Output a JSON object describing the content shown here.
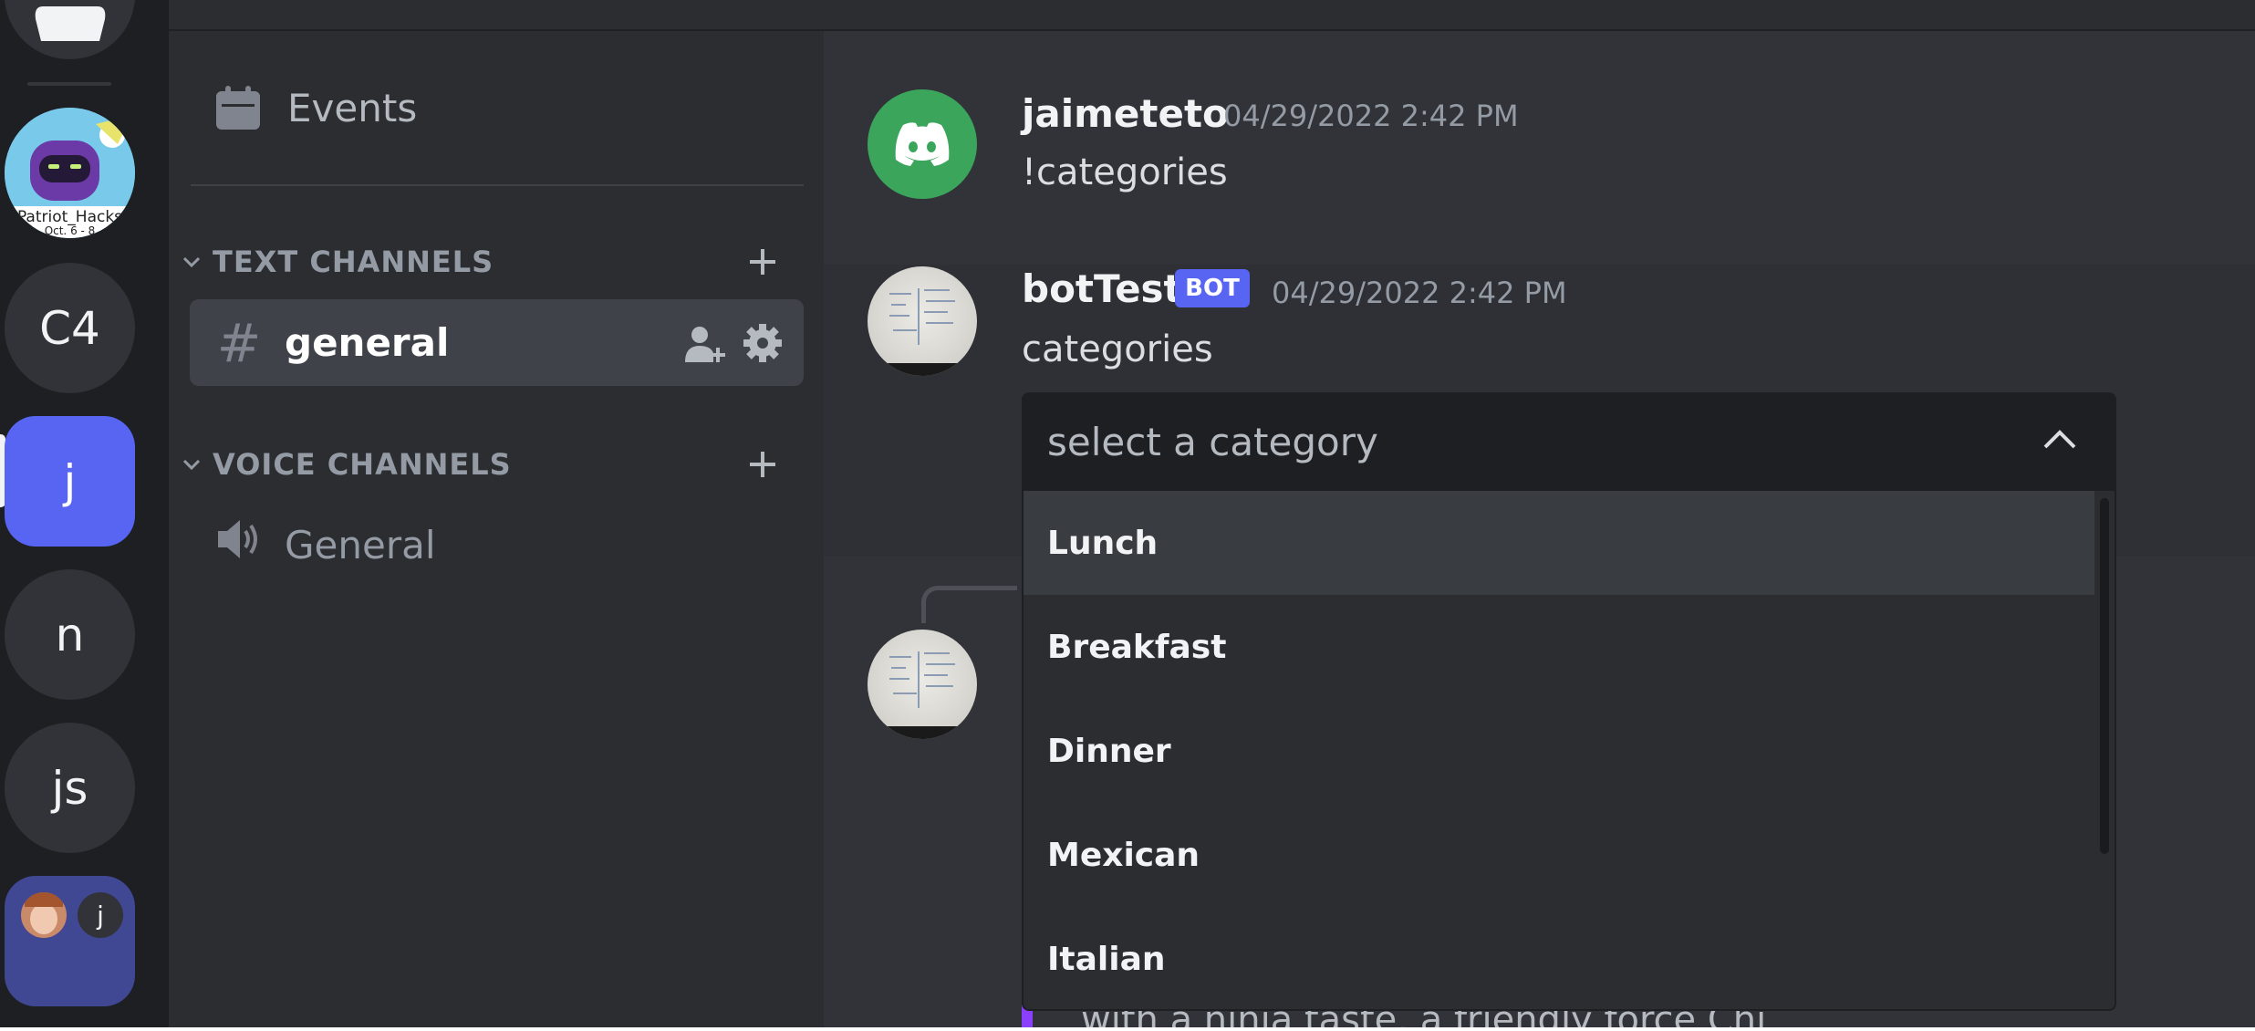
{
  "servers": {
    "items": [
      {
        "label": "",
        "name": "patriot-hacks"
      },
      {
        "label": "C4"
      },
      {
        "label": "j"
      },
      {
        "label": "n"
      },
      {
        "label": "js"
      }
    ],
    "folder_badge": "j",
    "patriot_text": "Patriot_Hacks",
    "patriot_date": "Oct. 6 - 8"
  },
  "sidebar": {
    "events_label": "Events",
    "text_category": "TEXT CHANNELS",
    "voice_category": "VOICE CHANNELS",
    "text_channels": [
      {
        "name": "general"
      }
    ],
    "voice_channels": [
      {
        "name": "General"
      }
    ]
  },
  "messages": [
    {
      "author": "jaimeteto",
      "timestamp": "04/29/2022 2:42 PM",
      "content": "!categories"
    },
    {
      "author": "botTest",
      "tag": "BOT",
      "timestamp": "04/29/2022 2:42 PM",
      "content": "categories"
    }
  ],
  "select_menu": {
    "placeholder": "select a category",
    "options": [
      "Lunch",
      "Breakfast",
      "Dinner",
      "Mexican",
      "Italian"
    ],
    "highlighted": "Lunch"
  },
  "partial_text": "…with a ninja taste, a friendly force Chi…",
  "colors": {
    "accent": "#5865f2",
    "rail_bg": "#1e1f22",
    "sidebar_bg": "#2b2d31",
    "chat_bg": "#313338",
    "online_green": "#3ba55c"
  }
}
